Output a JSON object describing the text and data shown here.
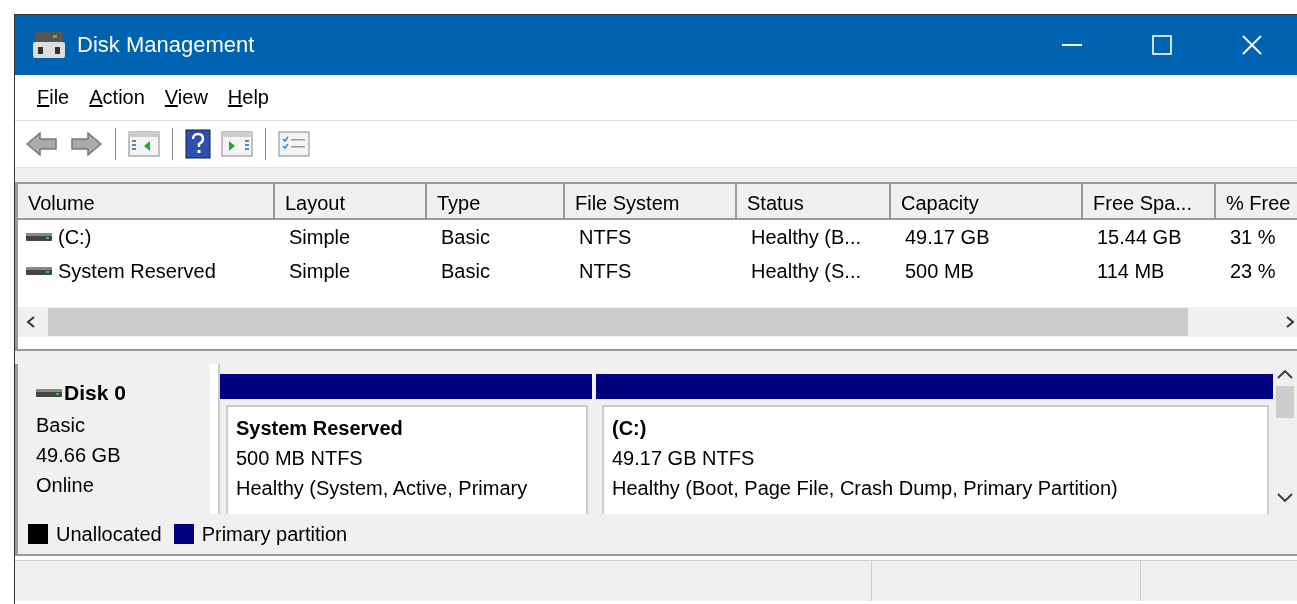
{
  "window": {
    "title": "Disk Management"
  },
  "menu": [
    {
      "label": "File"
    },
    {
      "label": "Action"
    },
    {
      "label": "View"
    },
    {
      "label": "Help"
    }
  ],
  "toolbar": [
    {
      "kind": "back"
    },
    {
      "kind": "forward"
    },
    {
      "kind": "separator"
    },
    {
      "kind": "tree"
    },
    {
      "kind": "separator"
    },
    {
      "kind": "help"
    },
    {
      "kind": "action"
    },
    {
      "kind": "separator"
    },
    {
      "kind": "properties"
    }
  ],
  "volumes": {
    "columns": [
      "Volume",
      "Layout",
      "Type",
      "File System",
      "Status",
      "Capacity",
      "Free Spa...",
      "% Free"
    ],
    "rows": [
      [
        "(C:)",
        "Simple",
        "Basic",
        "NTFS",
        "Healthy (B...",
        "49.17 GB",
        "15.44 GB",
        "31 %"
      ],
      [
        "System Reserved",
        "Simple",
        "Basic",
        "NTFS",
        "Healthy (S...",
        "500 MB",
        "114 MB",
        "23 %"
      ]
    ]
  },
  "disk": {
    "name": "Disk 0",
    "type": "Basic",
    "size": "49.66 GB",
    "state": "Online",
    "partitions": [
      {
        "name": "System Reserved",
        "size": "500 MB NTFS",
        "status": "Healthy (System, Active, Primary",
        "color": "#000080"
      },
      {
        "name": "(C:)",
        "size": "49.17 GB NTFS",
        "status": "Healthy (Boot, Page File, Crash Dump, Primary Partition)",
        "color": "#000080"
      }
    ]
  },
  "legend": [
    {
      "label": "Unallocated",
      "color": "#000000"
    },
    {
      "label": "Primary partition",
      "color": "#000080"
    }
  ]
}
